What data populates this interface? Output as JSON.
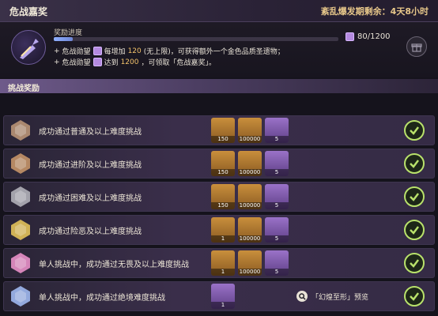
{
  "header": {
    "title": "危战嘉奖",
    "countdown": "紊乱爆发期剩余：4天8小时"
  },
  "progress": {
    "label": "奖励进度",
    "count": "80/1200",
    "fill_fraction": 0.067,
    "rule1_prefix": "危战勋望",
    "rule1_mid": "每增加",
    "rule1_value": "120",
    "rule1_suffix": "(无上限)，可获得额外一个金色品质圣遗物；",
    "rule2_prefix": "危战勋望",
    "rule2_mid": "达到",
    "rule2_value": "1200",
    "rule2_suffix": "，可领取「危战嘉奖」。"
  },
  "section": {
    "title": "挑战奖励"
  },
  "rows": [
    {
      "label": "成功通过普通及以上难度挑战",
      "tier_color": "#b89376",
      "items": [
        {
          "type": "gold",
          "count": "150"
        },
        {
          "type": "gold",
          "count": "100000"
        },
        {
          "type": "purple",
          "count": "5"
        }
      ]
    },
    {
      "label": "成功通过进阶及以上难度挑战",
      "tier_color": "#c49468",
      "items": [
        {
          "type": "gold",
          "count": "150"
        },
        {
          "type": "gold",
          "count": "100000"
        },
        {
          "type": "purple",
          "count": "5"
        }
      ]
    },
    {
      "label": "成功通过困难及以上难度挑战",
      "tier_color": "#b0b0b8",
      "items": [
        {
          "type": "gold",
          "count": "150"
        },
        {
          "type": "gold",
          "count": "100000"
        },
        {
          "type": "purple",
          "count": "5"
        }
      ]
    },
    {
      "label": "成功通过险恶及以上难度挑战",
      "tier_color": "#e2c25a",
      "items": [
        {
          "type": "gold",
          "count": "1"
        },
        {
          "type": "gold",
          "count": "100000"
        },
        {
          "type": "purple",
          "count": "5"
        }
      ]
    },
    {
      "label": "单人挑战中，成功通过无畏及以上难度挑战",
      "tier_color": "#e890c8",
      "items": [
        {
          "type": "gold",
          "count": "1"
        },
        {
          "type": "gold",
          "count": "100000"
        },
        {
          "type": "purple",
          "count": "5"
        }
      ]
    },
    {
      "label": "单人挑战中，成功通过绝境难度挑战",
      "tier_color": "#9fb8f0",
      "items": [
        {
          "type": "purple",
          "count": "1"
        }
      ],
      "preview": "「幻煌至形」预览"
    }
  ]
}
